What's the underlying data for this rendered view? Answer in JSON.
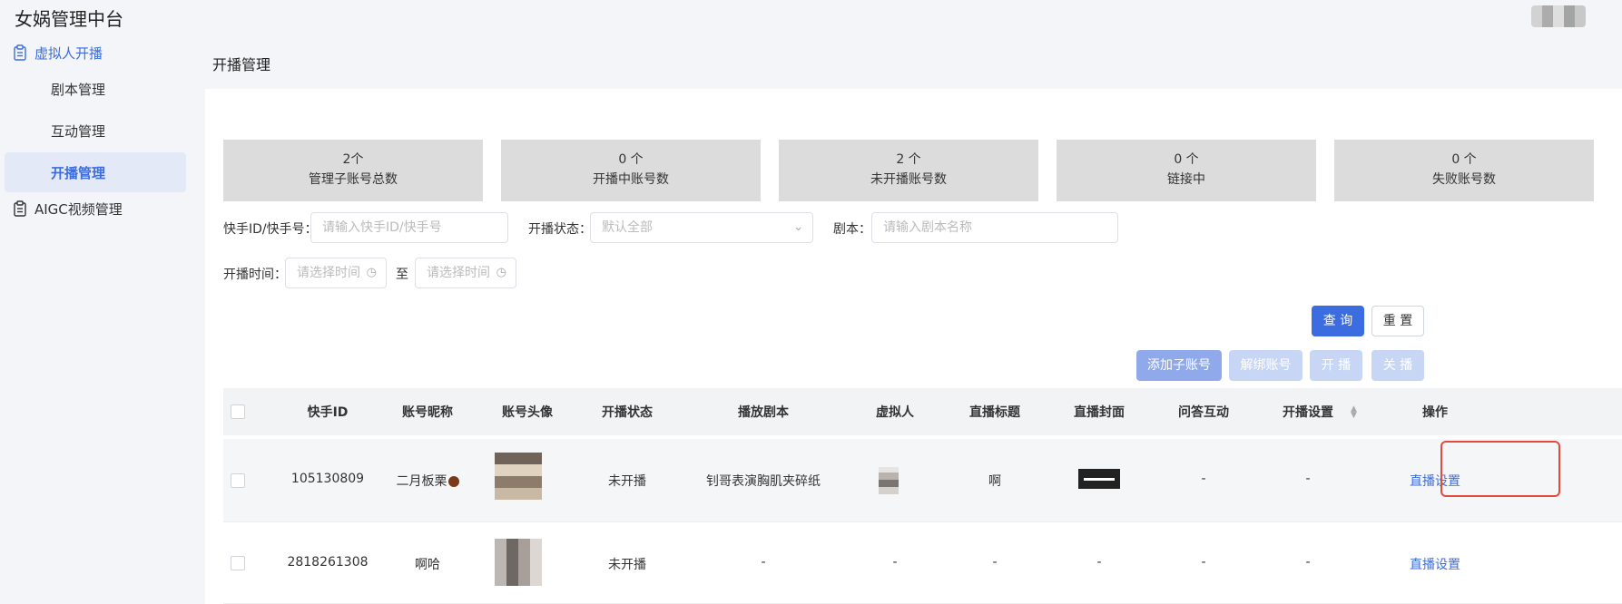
{
  "app": {
    "title": "女娲管理中台"
  },
  "sidebar": {
    "groups": [
      {
        "label": "虚拟人开播",
        "icon": "clipboard-icon"
      },
      {
        "label": "AIGC视频管理",
        "icon": "clipboard-icon"
      }
    ],
    "children": [
      {
        "label": "剧本管理"
      },
      {
        "label": "互动管理"
      },
      {
        "label": "开播管理"
      }
    ]
  },
  "page": {
    "title": "开播管理"
  },
  "stats": [
    {
      "value": "2个",
      "label": "管理子账号总数"
    },
    {
      "value": "0 个",
      "label": "开播中账号数"
    },
    {
      "value": "2 个",
      "label": "未开播账号数"
    },
    {
      "value": "0 个",
      "label": "链接中"
    },
    {
      "value": "0 个",
      "label": "失败账号数"
    }
  ],
  "filters": {
    "id_label": "快手ID/快手号：",
    "id_placeholder": "请输入快手ID/快手号",
    "status_label": "开播状态：",
    "status_value": "默认全部",
    "script_label": "剧本：",
    "script_placeholder": "请输入剧本名称",
    "time_label": "开播时间：",
    "time_start_placeholder": "请选择时间",
    "time_sep": "至",
    "time_end_placeholder": "请选择时间"
  },
  "buttons": {
    "query": "查 询",
    "reset": "重 置",
    "add_sub": "添加子账号",
    "unbind": "解绑账号",
    "start": "开 播",
    "stop": "关 播"
  },
  "table": {
    "headers": [
      "快手ID",
      "账号昵称",
      "账号头像",
      "开播状态",
      "播放剧本",
      "虚拟人",
      "直播标题",
      "直播封面",
      "问答互动",
      "开播设置",
      "操作"
    ],
    "rows": [
      {
        "id": "105130809",
        "nickname": "二月板栗",
        "status": "未开播",
        "script": "钊哥表演胸肌夹碎纸",
        "virtual": "",
        "title": "啊",
        "qa": "-",
        "setting": "-",
        "action": "直播设置"
      },
      {
        "id": "2818261308",
        "nickname": "啊哈",
        "status": "未开播",
        "script": "-",
        "virtual": "-",
        "title": "-",
        "cover": "-",
        "qa": "-",
        "setting": "-",
        "action": "直播设置"
      }
    ]
  }
}
